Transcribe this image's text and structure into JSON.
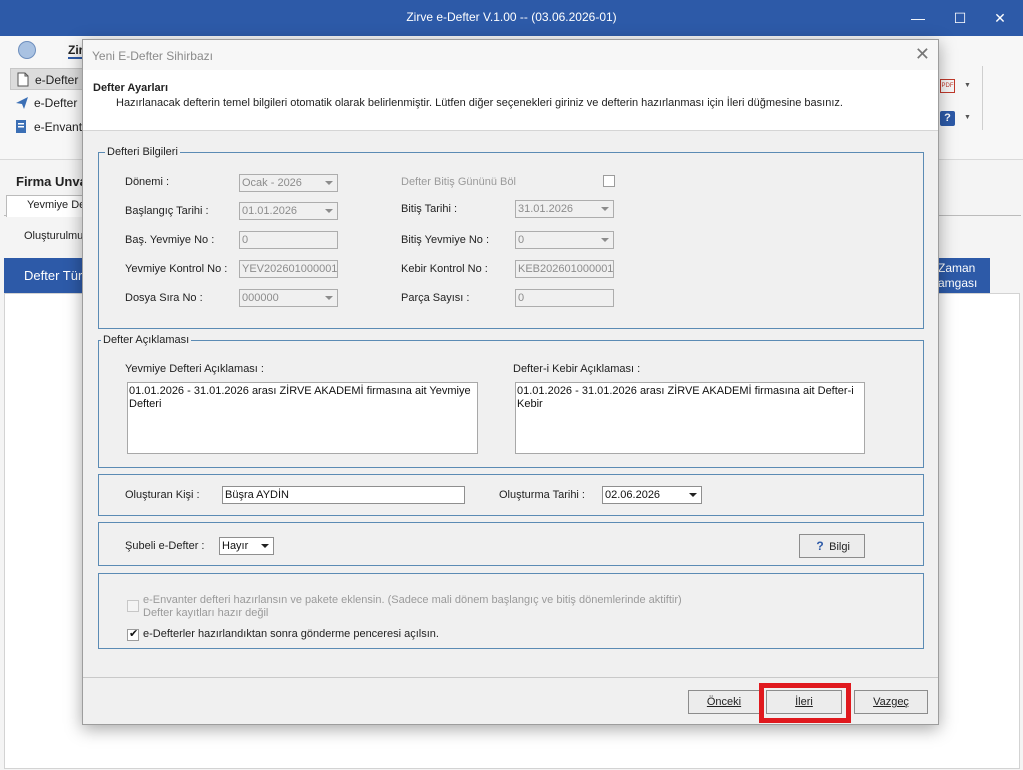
{
  "app": {
    "title": "Zirve e-Defter V.1.00  -- (03.06.2026-01)",
    "window_controls": {
      "minimize": "—",
      "maximize": "☐",
      "close": "✕"
    },
    "ribbon": {
      "first_tab": "Zir",
      "items": [
        "e-Defter",
        "e-Defter",
        "e-Envant"
      ]
    },
    "firma_label": "Firma Unva",
    "tab_label": "Yevmiye De",
    "olusturulmus_label": "Oluşturulmuş",
    "grid": {
      "left_header": "Defter Tür",
      "right_header": "Zaman\namgası"
    }
  },
  "dialog": {
    "title": "Yeni E-Defter Sihirbazı",
    "close_icon": "✕",
    "header_title": "Defter Ayarları",
    "header_desc": "Hazırlanacak defterin temel bilgileri otomatik olarak belirlenmiştir. Lütfen diğer seçenekleri giriniz ve defterin hazırlanması için İleri düğmesine basınız.",
    "defteri_bilgileri": {
      "legend": "Defteri Bilgileri",
      "donemi_label": "Dönemi :",
      "donemi_value": "Ocak - 2026",
      "baslangic_label": "Başlangıç Tarihi :",
      "baslangic_value": "01.01.2026",
      "bas_yevmiye_label": "Baş. Yevmiye No :",
      "bas_yevmiye_value": "0",
      "yevmiye_kontrol_label": "Yevmiye Kontrol No :",
      "yevmiye_kontrol_value": "YEV202601000001",
      "dosya_sira_label": "Dosya Sıra No :",
      "dosya_sira_value": "000000",
      "bitis_gunu_label": "Defter Bitiş Gününü Böl",
      "bitis_tarihi_label": "Bitiş Tarihi :",
      "bitis_tarihi_value": "31.01.2026",
      "bitis_yevmiye_label": "Bitiş Yevmiye No :",
      "bitis_yevmiye_value": "0",
      "kebir_kontrol_label": "Kebir Kontrol No :",
      "kebir_kontrol_value": "KEB202601000001",
      "parca_sayisi_label": "Parça Sayısı :",
      "parca_sayisi_value": "0"
    },
    "defter_aciklamasi": {
      "legend": "Defter Açıklaması",
      "yevmiye_label": "Yevmiye Defteri Açıklaması :",
      "yevmiye_text": "01.01.2026 - 31.01.2026 arası ZİRVE AKADEMİ  firmasına ait Yevmiye Defteri",
      "kebir_label": "Defter-i Kebir Açıklaması :",
      "kebir_text": "01.01.2026 - 31.01.2026 arası ZİRVE AKADEMİ  firmasına ait Defter-i Kebir"
    },
    "olusturan": {
      "kisi_label": "Oluşturan Kişi :",
      "kisi_value": "Büşra AYDİN",
      "tarih_label": "Oluşturma Tarihi :",
      "tarih_value": "02.06.2026"
    },
    "subeli": {
      "label": "Şubeli e-Defter :",
      "value": "Hayır",
      "bilgi_label": "Bilgi",
      "bilgi_icon": "?"
    },
    "options": {
      "envanter_label": "e-Envanter defteri hazırlansın ve pakete eklensin. (Sadece mali dönem başlangıç ve bitiş dönemlerinde aktiftir)",
      "envanter_note": "Defter kayıtları hazır değil",
      "gonderme_label": "e-Defterler hazırlandıktan sonra gönderme penceresi açılsın.",
      "gonderme_checked": "✔"
    },
    "buttons": {
      "onceki": "Önceki",
      "ileri": "İleri",
      "vazgec": "Vazgeç"
    }
  }
}
